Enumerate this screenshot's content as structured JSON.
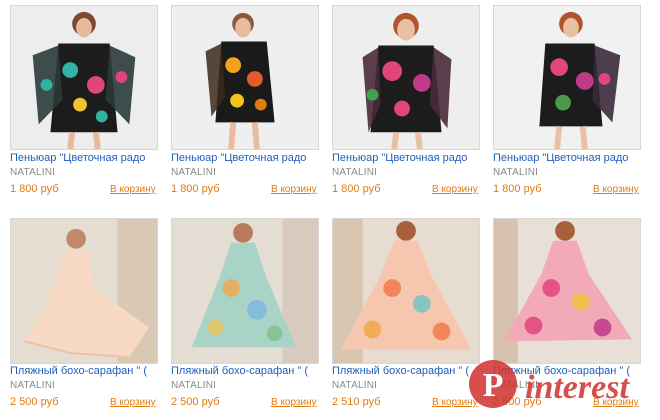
{
  "products": [
    {
      "title": "Пеньюар \"Цветочная радо",
      "brand": "NATALINI",
      "price": "1 800 руб",
      "cart_label": "В корзину",
      "image_alt": "model in black floral robe"
    },
    {
      "title": "Пеньюар \"Цветочная радо",
      "brand": "NATALINI",
      "price": "1 800 руб",
      "cart_label": "В корзину",
      "image_alt": "model in black floral robe"
    },
    {
      "title": "Пеньюар \"Цветочная радо",
      "brand": "NATALINI",
      "price": "1 800 руб",
      "cart_label": "В корзину",
      "image_alt": "model in black floral robe"
    },
    {
      "title": "Пеньюар \"Цветочная радо",
      "brand": "NATALINI",
      "price": "1 800 руб",
      "cart_label": "В корзину",
      "image_alt": "model in black floral robe"
    },
    {
      "title": "Пляжный бохо-сарафан \" (",
      "brand": "NATALINI",
      "price": "2 500 руб",
      "cart_label": "В корзину",
      "image_alt": "model in peach boho sundress"
    },
    {
      "title": "Пляжный бохо-сарафан \" (",
      "brand": "NATALINI",
      "price": "2 500 руб",
      "cart_label": "В корзину",
      "image_alt": "model in blue-green boho sundress"
    },
    {
      "title": "Пляжный бохо-сарафан \" (",
      "brand": "NATALINI",
      "price": "2 510 руб",
      "cart_label": "В корзину",
      "image_alt": "model in coral boho sundress"
    },
    {
      "title": "Пляжный бохо-сарафан \" (",
      "brand": "NATALINI",
      "price": "2 500 руб",
      "cart_label": "В корзину",
      "image_alt": "model in pink boho sundress"
    }
  ],
  "colors": {
    "link": "#1f5fb7",
    "price": "#e07b12",
    "brand": "#8a8a8a",
    "thumb_border": "#d7d7d7",
    "watermark": "#d0312d"
  },
  "watermark": {
    "icon": "pinterest-logo",
    "text": "Pinterest"
  }
}
